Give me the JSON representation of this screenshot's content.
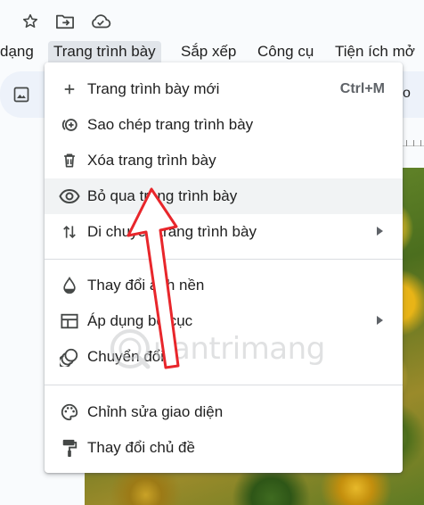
{
  "top_icons": [
    "star-icon",
    "move-to-folder-icon",
    "cloud-status-icon"
  ],
  "menubar": {
    "items": [
      "dạng",
      "Trang trình bày",
      "Sắp xếp",
      "Công cụ",
      "Tiện ích mở"
    ],
    "active_index": 1
  },
  "toolbar": {
    "icon": "image-icon",
    "right_text": "o"
  },
  "menu": {
    "items": [
      {
        "label": "Trang trình bày mới",
        "icon": "plus-icon",
        "shortcut": "Ctrl+M"
      },
      {
        "label": "Sao chép trang trình bày",
        "icon": "duplicate-icon"
      },
      {
        "label": "Xóa trang trình bày",
        "icon": "trash-icon"
      },
      {
        "label": "Bỏ qua trang trình bày",
        "icon": "eye-icon",
        "highlighted": true
      },
      {
        "label": "Di chuyển trang trình bày",
        "icon": "move-arrows-icon",
        "submenu": true
      },
      {
        "label": "Thay đổi ảnh nền",
        "icon": "drop-icon"
      },
      {
        "label": "Áp dụng bố cục",
        "icon": "layout-icon",
        "submenu": true
      },
      {
        "label": "Chuyển đổi",
        "icon": "transition-icon"
      },
      {
        "label": "Chỉnh sửa giao diện",
        "icon": "palette-icon"
      },
      {
        "label": "Thay đổi chủ đề",
        "icon": "paint-roller-icon"
      }
    ]
  },
  "watermark": {
    "text": "uantrimang"
  },
  "colors": {
    "accent_annotation": "#e8262b",
    "menu_highlight": "#f1f3f4",
    "toolbar_bg": "#edf2fa"
  }
}
